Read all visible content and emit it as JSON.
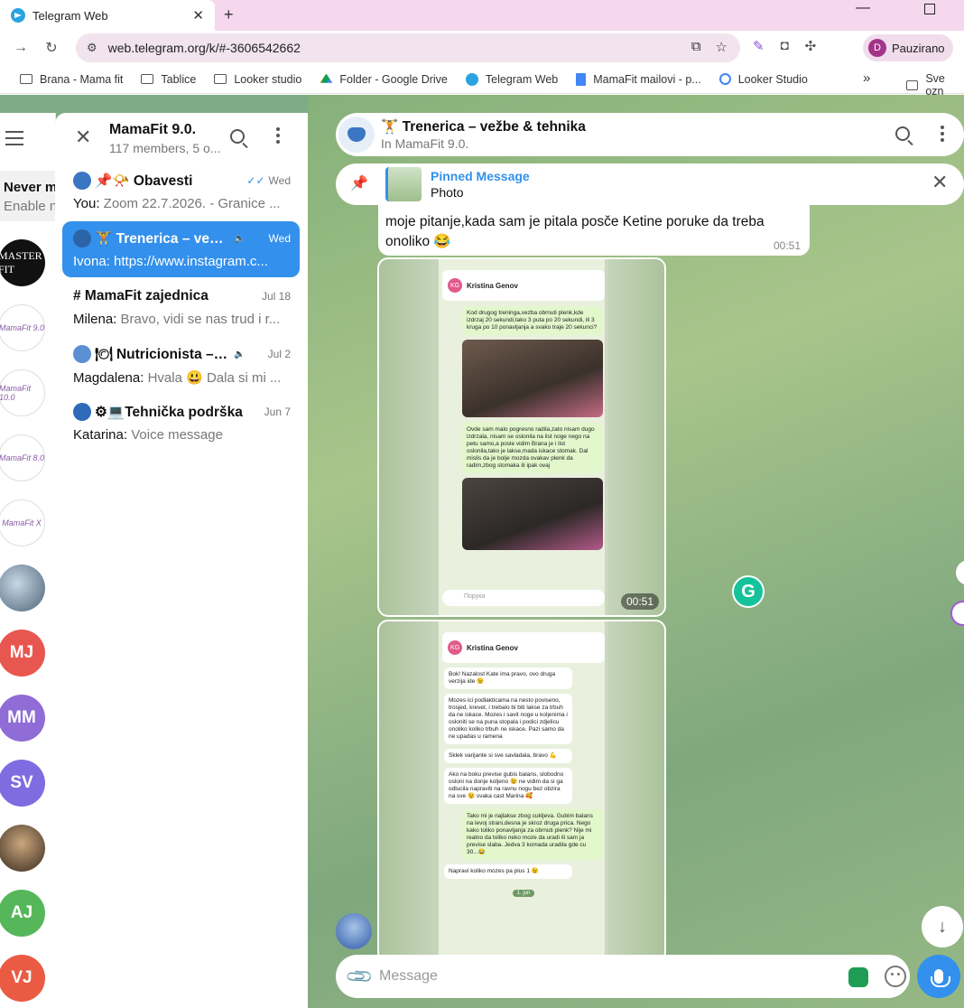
{
  "browser": {
    "tab_title": "Telegram Web",
    "url": "web.telegram.org/k/#-3606542662",
    "profile_initial": "D",
    "profile_name": "Pauzirano"
  },
  "bookmarks": [
    {
      "label": "Brana - Mama fit",
      "icon": "folder-icon"
    },
    {
      "label": "Tablice",
      "icon": "folder-icon"
    },
    {
      "label": "Looker studio",
      "icon": "folder-icon"
    },
    {
      "label": "Folder - Google Drive",
      "icon": "drive-icon"
    },
    {
      "label": "Telegram Web",
      "icon": "telegram-icon"
    },
    {
      "label": "MamaFit mailovi - p...",
      "icon": "docs-icon"
    },
    {
      "label": "Looker Studio",
      "icon": "looker-icon"
    }
  ],
  "bookmarks_overflow": "»",
  "bookmarks_last": "Sve ozn",
  "rail": {
    "never_title": "Never m",
    "never_sub": "Enable n",
    "avatars": [
      {
        "label": "MASTER FIT",
        "kind": "logo"
      },
      {
        "label": "MamaFit 9.0",
        "kind": "mama"
      },
      {
        "label": "MamaFit 10.0",
        "kind": "mama"
      },
      {
        "label": "MamaFit 8.0",
        "kind": "mama"
      },
      {
        "label": "MamaFit X",
        "kind": "mama"
      },
      {
        "label": "",
        "kind": "photo"
      },
      {
        "label": "MJ",
        "kind": "initials",
        "color": "#e8574f"
      },
      {
        "label": "MM",
        "kind": "initials",
        "color": "#8f6cd6"
      },
      {
        "label": "SV",
        "kind": "initials",
        "color": "#7e6ce0"
      },
      {
        "label": "",
        "kind": "photo"
      },
      {
        "label": "AJ",
        "kind": "initials",
        "color": "#56b75a"
      },
      {
        "label": "VJ",
        "kind": "initials",
        "color": "#ea5b43"
      }
    ]
  },
  "group": {
    "title": "MamaFit 9.0.",
    "subtitle": "117 members, 5 o..."
  },
  "chats": [
    {
      "name": "📌📯 Obavesti",
      "date": "Wed",
      "sender": "You:",
      "preview": "Zoom 22.7.2026. - Granice ...",
      "active": false,
      "read": true,
      "muted": false
    },
    {
      "name": "🏋 Trenerica – vežbe...",
      "date": "Wed",
      "sender": "Ivona:",
      "preview": "https://www.instagram.c...",
      "active": true,
      "read": false,
      "muted": true
    },
    {
      "name": "# MamaFit zajednica",
      "date": "Jul 18",
      "sender": "Milena:",
      "preview": "Bravo, vidi se nas trud i r...",
      "active": false,
      "read": false,
      "muted": false
    },
    {
      "name": "🍽 Nutricionista – is...",
      "date": "Jul 2",
      "sender": "Magdalena:",
      "preview": "Hvala 😃 Dala si mi ...",
      "active": false,
      "read": false,
      "muted": true
    },
    {
      "name": "⚙💻Tehnička podrška",
      "date": "Jun 7",
      "sender": "Katarina:",
      "preview": "Voice message",
      "active": false,
      "read": false,
      "muted": false
    }
  ],
  "chat": {
    "title": "🏋 Trenerica – vežbe & tehnika",
    "subtitle": "In MamaFit 9.0.",
    "pinned_title": "Pinned Message",
    "pinned_sub": "Photo",
    "message_text": "moje pitanje,kada sam je pitala posče Ketine poruke da treba onoliko 😂",
    "message_time": "00:51",
    "photo1_time": "00:51",
    "composer_placeholder": "Message"
  },
  "photo1": {
    "contact": "Kristina Genov",
    "b1": "Kod drugog treninga,vezba obrnuti plenk,kde izdrzaj 20 sekundi,tako 3 puta po 20 sekundi, ili 3 kruga po 10 ponavljanja a svako traje 20 sekunci?",
    "b2": "Ovde sam malo pogresno radila,zato nisam dugo izdrzala, nisam se oslonila na list noge nego na petu samo,a posle vidim Brana je i list oslonila,tako je lakse,mada iskace stomak. Dal mislis da je bolje mozda ovakav plenk da radim,zbog stomaka ili ipak ovaj",
    "input": "Порука"
  },
  "photo2": {
    "contact": "Kristina Genov",
    "b1": "Bok! Nazalost Kate ima pravo, ovo druga verzija ide 😉",
    "b2": "Mozes ici podlakticama na nesto poviseno, trosjed, krevet, i trebalo bi biti lakse za trbuh da ne iskace. Mozes i savit noge u koljenima i osloniti se na puna stopala i podici zdjelicu onoliko koliko trbuh ne iskace. Pazi samo da ne upadas u ramena",
    "b3": "Sklek varijante si sve savladala, bravo 💪",
    "b4": "Ako na boku previse gubis balans, slobodno osloni na donje koljeno 😉 ne vidim da si ga odlucila napraviti na ravnu nogu bez obzira na sve 😉 svaka cast Marina 🥰",
    "b5": "Tako mi je najlakse zbog cukljeva. Gubim balans na levoj strani,desna je skroz druga prica. Nego kako toliko ponavljanja za obrnuti plenk? Nije mi realno da toliko neko moze da uradi ili sam ja previse slaba. Jedva 3 komada uradila gde cu 30...😂",
    "b6": "Napravi koliko mozes pa plus 1 😉",
    "date": "1. jun"
  }
}
